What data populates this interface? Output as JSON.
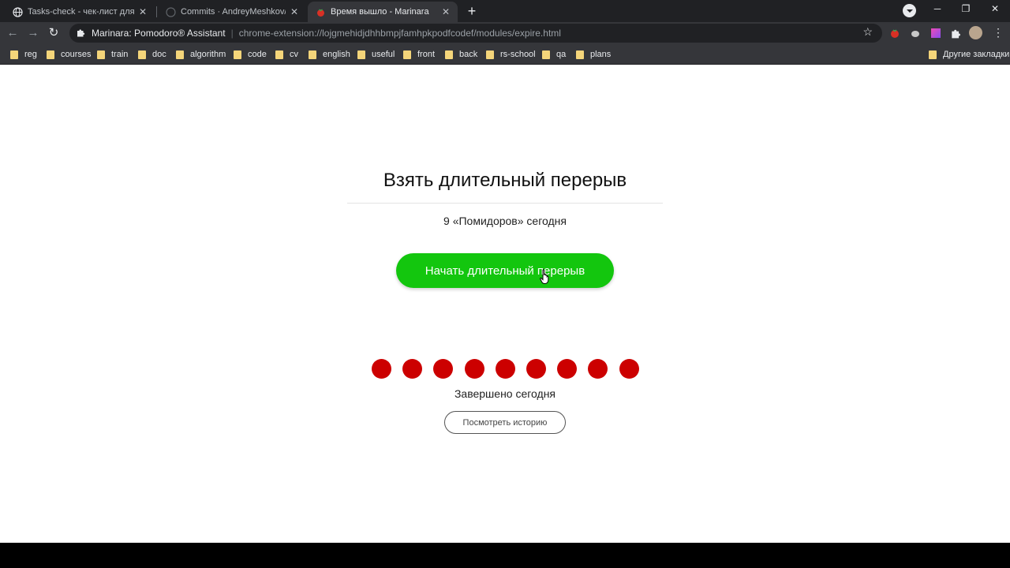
{
  "browser": {
    "tabs": [
      {
        "title": "Tasks-check - чек-лист для пров",
        "icon": "globe-icon",
        "active": false
      },
      {
        "title": "Commits · AndreyMeshkov/clean",
        "icon": "github-icon",
        "active": false
      },
      {
        "title": "Время вышло - Marinara",
        "icon": "tomato-icon",
        "active": true
      }
    ],
    "new_tab": "+",
    "window_controls": {
      "minimize": "─",
      "restore": "❐",
      "close": "✕"
    },
    "nav": {
      "back": "←",
      "forward": "→",
      "reload": "↻"
    },
    "address": {
      "site_name": "Marinara: Pomodoro® Assistant",
      "separator": "|",
      "url": "chrome-extension://lojgmehidjdhhbmpjfamhpkpodfcodef/modules/expire.html",
      "star": "☆"
    },
    "bookmarks": [
      "reg",
      "courses",
      "train",
      "doc",
      "algorithm",
      "code",
      "cv",
      "english",
      "useful",
      "front",
      "back",
      "rs-school",
      "qa",
      "plans"
    ],
    "other_bookmarks": "Другие закладки"
  },
  "page": {
    "heading": "Взять длительный перерыв",
    "count_text": "9 «Помидоров» сегодня",
    "start_button": "Начать длительный перерыв",
    "completed_count": 9,
    "completed_label": "Завершено сегодня",
    "history_button": "Посмотреть историю",
    "colors": {
      "accent_green": "#13c60e",
      "tomato_red": "#cc0000"
    }
  }
}
